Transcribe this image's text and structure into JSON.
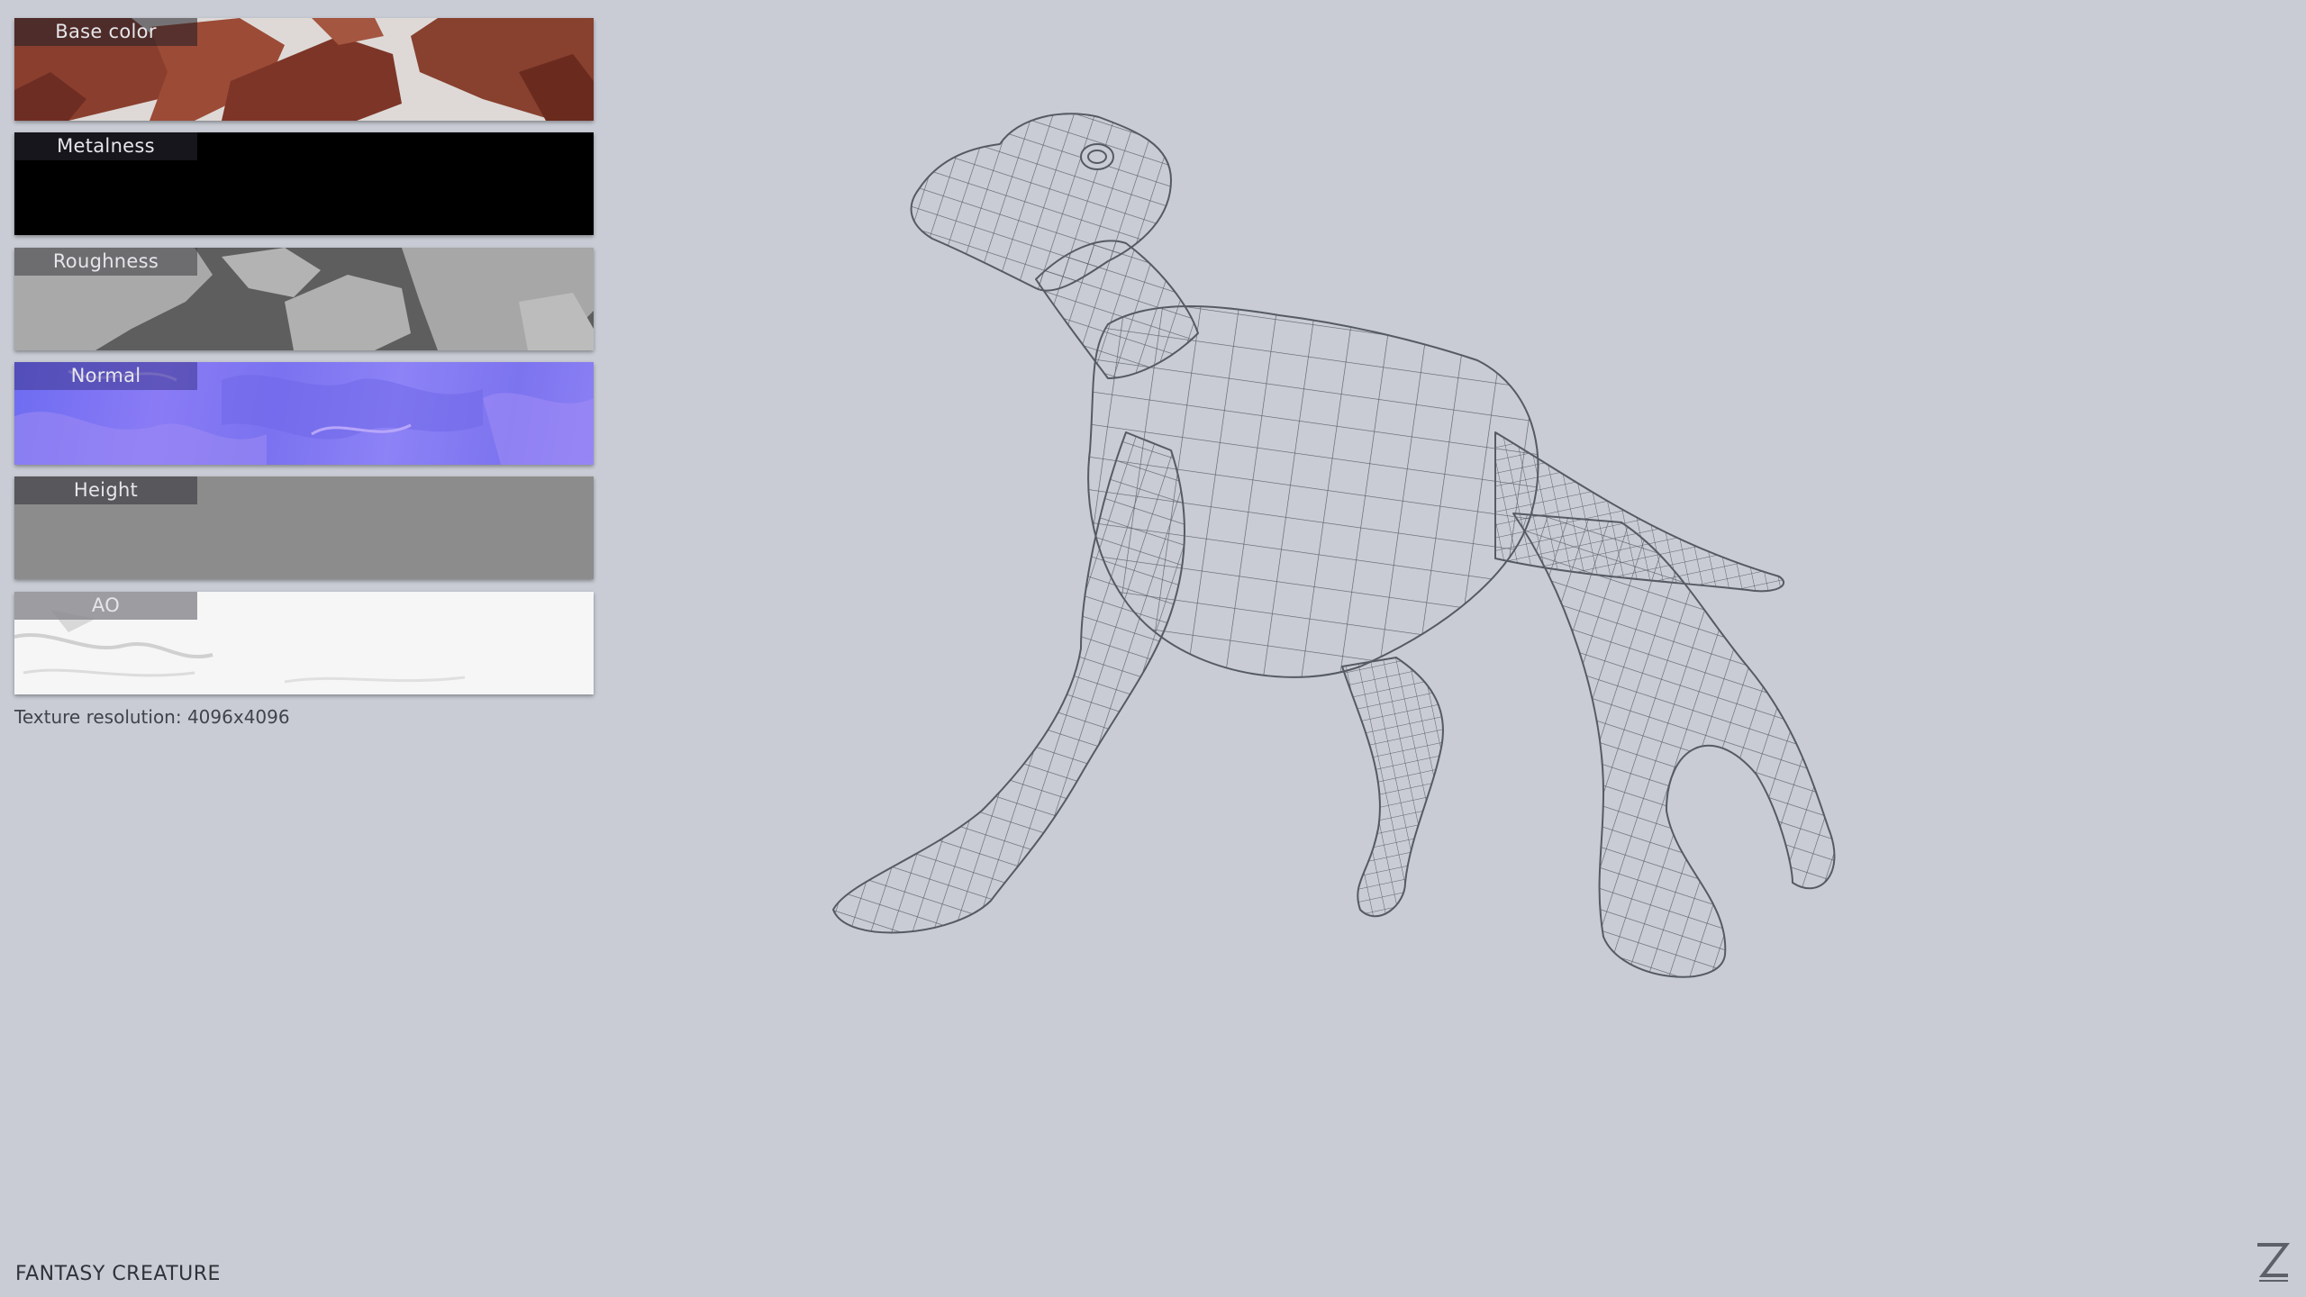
{
  "texture_maps": [
    {
      "label": "Base color"
    },
    {
      "label": "Metalness"
    },
    {
      "label": "Roughness"
    },
    {
      "label": "Normal"
    },
    {
      "label": "Height"
    },
    {
      "label": "AO"
    }
  ],
  "resolution_text": "Texture resolution: 4096x4096",
  "title": "FANTASY CREATURE",
  "logo_icon": "z-logo-icon",
  "colors": {
    "background": "#c9ccd5",
    "wireframe": "#555a63"
  }
}
